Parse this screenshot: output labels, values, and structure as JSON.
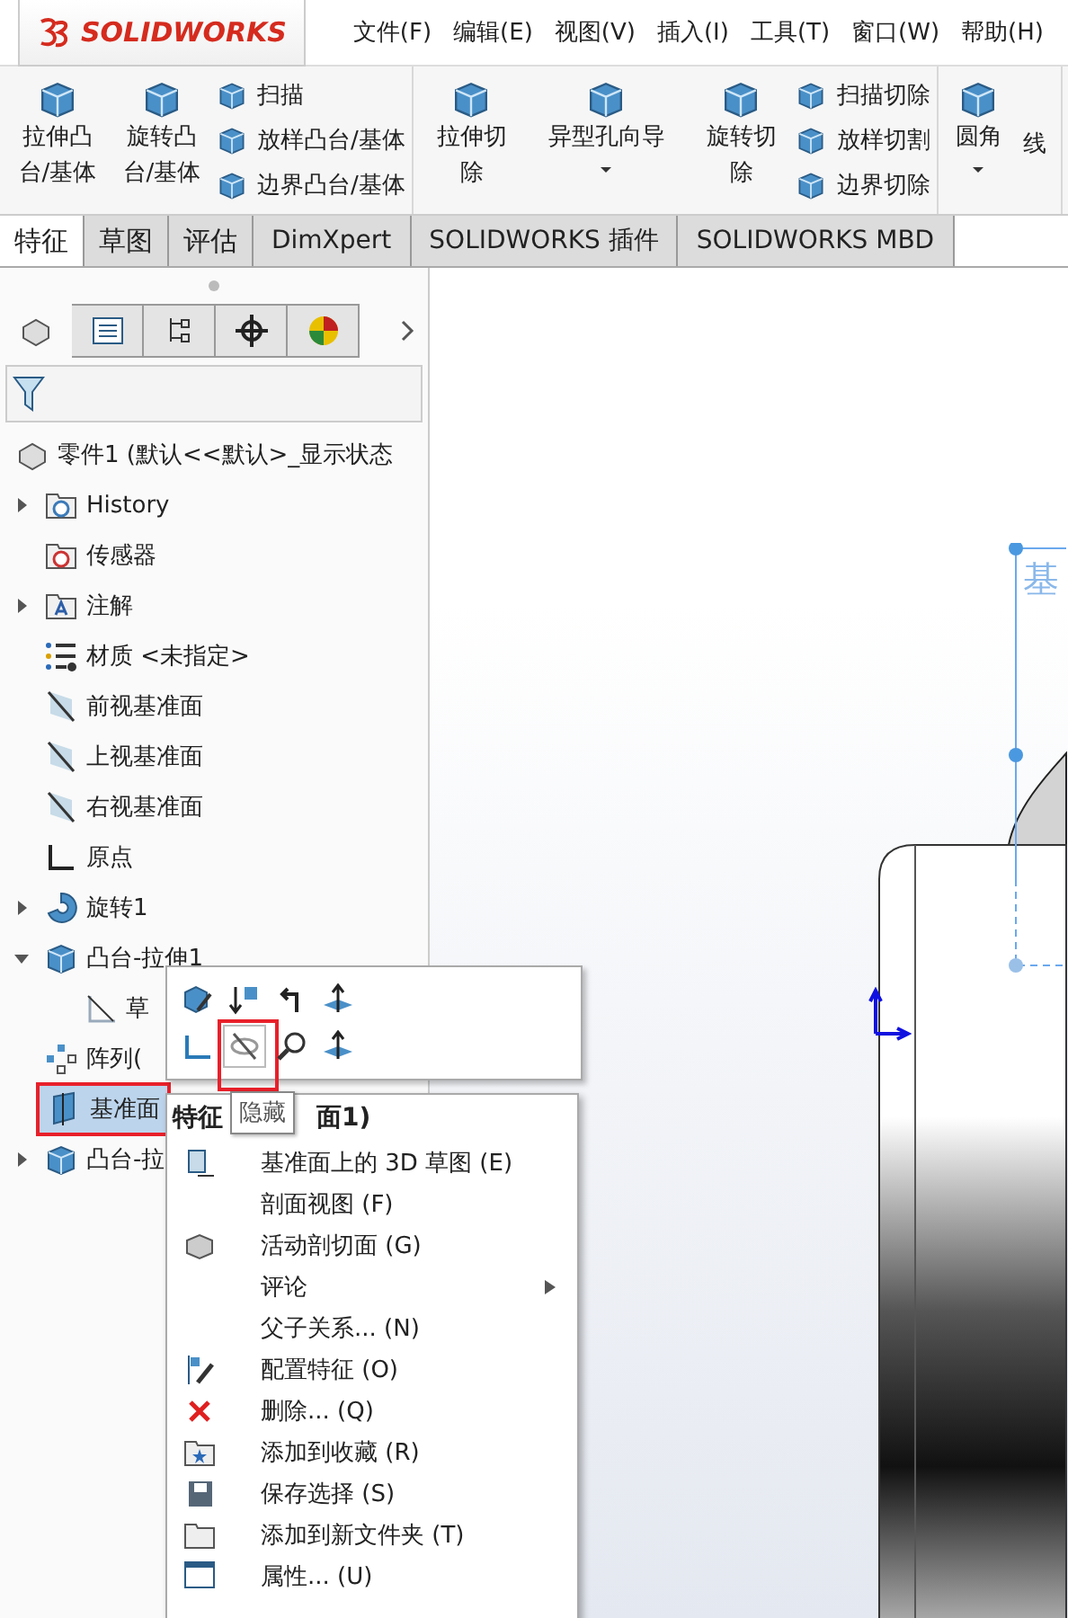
{
  "app": {
    "logo": "SOLIDWORKS"
  },
  "menu_bar": [
    "文件(F)",
    "编辑(E)",
    "视图(V)",
    "插入(I)",
    "工具(T)",
    "窗口(W)",
    "帮助(H)"
  ],
  "ribbon": {
    "groups": [
      {
        "items": [
          {
            "kind": "large",
            "label": "拉伸凸台/基体"
          },
          {
            "kind": "large",
            "label": "旋转凸台/基体"
          },
          {
            "kind": "small",
            "label": "扫描"
          },
          {
            "kind": "small",
            "label": "放样凸台/基体"
          },
          {
            "kind": "small",
            "label": "边界凸台/基体"
          }
        ]
      },
      {
        "items": [
          {
            "kind": "large",
            "label": "拉伸切除"
          },
          {
            "kind": "dropdown",
            "label": "异型孔向导"
          },
          {
            "kind": "large",
            "label": "旋转切除"
          },
          {
            "kind": "small",
            "label": "扫描切除"
          },
          {
            "kind": "small",
            "label": "放样切割"
          },
          {
            "kind": "small",
            "label": "边界切除"
          }
        ]
      },
      {
        "items": [
          {
            "kind": "dropdown",
            "label": "圆角"
          },
          {
            "kind": "cut",
            "label": "线"
          }
        ]
      }
    ]
  },
  "tabs": [
    {
      "label": "特征",
      "selected": true
    },
    {
      "label": "草图",
      "selected": false
    },
    {
      "label": "评估",
      "selected": false
    },
    {
      "label": "DimXpert",
      "selected": false
    },
    {
      "label": "SOLIDWORKS 插件",
      "selected": false
    },
    {
      "label": "SOLIDWORKS MBD",
      "selected": false
    }
  ],
  "panel_tabs": [
    {
      "kind": "part",
      "selected": true
    },
    {
      "kind": "list",
      "selected": false
    },
    {
      "kind": "tree",
      "selected": false
    },
    {
      "kind": "target",
      "selected": false
    },
    {
      "kind": "ball",
      "selected": false
    }
  ],
  "tree": {
    "root": "零件1  (默认<<默认>_显示状态",
    "items": [
      {
        "kind": "folder",
        "label": "History",
        "expanded": false
      },
      {
        "kind": "sensor",
        "label": "传感器"
      },
      {
        "kind": "note",
        "label": "注解",
        "expanded": false
      },
      {
        "kind": "material",
        "label": "材质 <未指定>"
      },
      {
        "kind": "plane",
        "label": "前视基准面"
      },
      {
        "kind": "plane",
        "label": "上视基准面"
      },
      {
        "kind": "plane",
        "label": "右视基准面"
      },
      {
        "kind": "origin",
        "label": "原点"
      },
      {
        "kind": "revolve",
        "label": "旋转1",
        "expanded": false
      },
      {
        "kind": "extrude",
        "label": "凸台-拉伸1",
        "expanded": true,
        "children": [
          {
            "kind": "sketch",
            "label": "草"
          }
        ]
      },
      {
        "kind": "pattern",
        "label": "阵列("
      },
      {
        "kind": "datum",
        "label": "基准面",
        "selected": true,
        "marked": true
      },
      {
        "kind": "extrude",
        "label": "凸台-拉",
        "expanded": false
      }
    ]
  },
  "viewport": {
    "plane_label": "基"
  },
  "popup_toolbar": [
    {
      "kind": "edit",
      "highlighted": false,
      "marked": false
    },
    {
      "kind": "order",
      "highlighted": false,
      "marked": false
    },
    {
      "kind": "back",
      "highlighted": false,
      "marked": false
    },
    {
      "kind": "normal",
      "highlighted": false,
      "marked": false
    },
    {
      "kind": "sketch",
      "highlighted": false,
      "marked": false
    },
    {
      "kind": "hide",
      "highlighted": true,
      "marked": true
    },
    {
      "kind": "zoom",
      "highlighted": false,
      "marked": false
    },
    {
      "kind": "normal2",
      "highlighted": false,
      "marked": false
    }
  ],
  "tooltip": "隐藏",
  "context_menu": {
    "title": "特征",
    "title_tail": "面1)",
    "items": [
      {
        "kind": "sketch3d",
        "label": "基准面上的 3D 草图 (E)",
        "submenu": false
      },
      {
        "kind": "plain",
        "label": "剖面视图 (F)",
        "submenu": false
      },
      {
        "kind": "cut",
        "label": "活动剖切面 (G)",
        "submenu": false
      },
      {
        "kind": "plain",
        "label": "评论",
        "submenu": true
      },
      {
        "kind": "plain",
        "label": "父子关系... (N)",
        "submenu": false
      },
      {
        "kind": "config",
        "label": "配置特征 (O)",
        "submenu": false
      },
      {
        "kind": "delete",
        "label": "删除... (Q)",
        "submenu": false
      },
      {
        "kind": "favorite",
        "label": "添加到收藏 (R)",
        "submenu": false
      },
      {
        "kind": "save",
        "label": "保存选择 (S)",
        "submenu": false
      },
      {
        "kind": "folder",
        "label": "添加到新文件夹 (T)",
        "submenu": false
      },
      {
        "kind": "props",
        "label": "属性... (U)",
        "submenu": false
      }
    ]
  }
}
